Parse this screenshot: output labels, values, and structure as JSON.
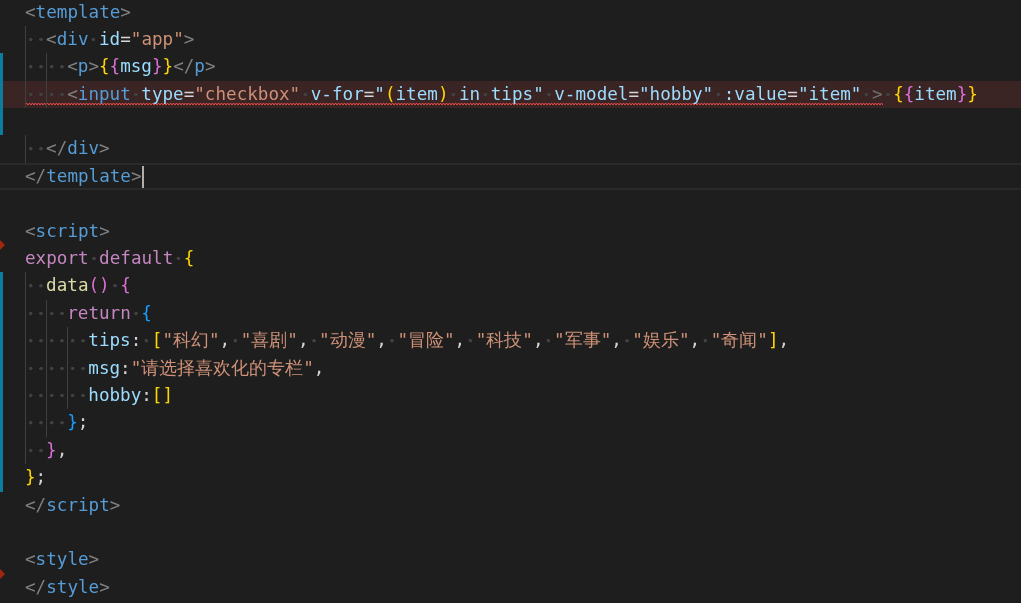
{
  "editor": {
    "lines": [
      {
        "modified": false,
        "deleted": false,
        "error": false,
        "current": false,
        "tokens": [
          {
            "kind": "bracket",
            "text": "<"
          },
          {
            "kind": "tag",
            "text": "template"
          },
          {
            "kind": "bracket",
            "text": ">"
          }
        ]
      },
      {
        "modified": false,
        "deleted": false,
        "error": false,
        "current": false,
        "tokens": [
          {
            "kind": "bracket",
            "text": "  <"
          },
          {
            "kind": "tag",
            "text": "div"
          },
          {
            "kind": "attr",
            "text": " id"
          },
          {
            "kind": "punct",
            "text": "="
          },
          {
            "kind": "string",
            "text": "\"app\""
          },
          {
            "kind": "bracket",
            "text": ">"
          }
        ]
      },
      {
        "modified": true,
        "deleted": false,
        "error": false,
        "current": false,
        "tokens": [
          {
            "kind": "bracket",
            "text": "    <"
          },
          {
            "kind": "tag",
            "text": "p"
          },
          {
            "kind": "bracket",
            "text": ">"
          },
          {
            "kind": "brace1",
            "text": "{"
          },
          {
            "kind": "brace2",
            "text": "{"
          },
          {
            "kind": "var",
            "text": "msg"
          },
          {
            "kind": "brace2",
            "text": "}"
          },
          {
            "kind": "brace1",
            "text": "}"
          },
          {
            "kind": "bracket",
            "text": "</"
          },
          {
            "kind": "tag",
            "text": "p"
          },
          {
            "kind": "bracket",
            "text": ">"
          }
        ]
      },
      {
        "modified": true,
        "deleted": false,
        "error": true,
        "current": false,
        "segments": [
          {
            "squiggle": true,
            "tokens": [
              {
                "kind": "bracket",
                "text": "    <"
              },
              {
                "kind": "tag",
                "text": "input"
              },
              {
                "kind": "attr",
                "text": " type"
              },
              {
                "kind": "punct",
                "text": "="
              },
              {
                "kind": "string",
                "text": "\"checkbox\""
              },
              {
                "kind": "attr",
                "text": " v-for"
              },
              {
                "kind": "punct",
                "text": "="
              },
              {
                "kind": "var",
                "text": "\""
              },
              {
                "kind": "brace1",
                "text": "("
              },
              {
                "kind": "var",
                "text": "item"
              },
              {
                "kind": "brace1",
                "text": ")"
              },
              {
                "kind": "var",
                "text": " in tips\""
              },
              {
                "kind": "attr",
                "text": " v-model"
              },
              {
                "kind": "punct",
                "text": "="
              },
              {
                "kind": "var",
                "text": "\"hobby\""
              },
              {
                "kind": "attr",
                "text": " :value"
              },
              {
                "kind": "punct",
                "text": "="
              },
              {
                "kind": "var",
                "text": "\"item\""
              },
              {
                "kind": "dim",
                "text": " >"
              }
            ]
          },
          {
            "squiggle": false,
            "tokens": [
              {
                "kind": "brace1",
                "text": " {"
              },
              {
                "kind": "brace2",
                "text": "{"
              },
              {
                "kind": "var",
                "text": "item"
              },
              {
                "kind": "brace2",
                "text": "}"
              },
              {
                "kind": "brace1",
                "text": "}"
              }
            ]
          }
        ]
      },
      {
        "modified": true,
        "deleted": false,
        "error": false,
        "current": false
      },
      {
        "modified": false,
        "deleted": false,
        "error": false,
        "current": false,
        "tokens": [
          {
            "kind": "bracket",
            "text": "  </"
          },
          {
            "kind": "tag",
            "text": "div"
          },
          {
            "kind": "bracket",
            "text": ">"
          }
        ]
      },
      {
        "modified": false,
        "deleted": false,
        "error": false,
        "current": true,
        "tokens": [
          {
            "kind": "bracket",
            "text": "</"
          },
          {
            "kind": "tag",
            "text": "template"
          },
          {
            "kind": "bracket",
            "text": ">"
          }
        ]
      },
      {
        "modified": false,
        "deleted": false,
        "error": false,
        "current": false
      },
      {
        "modified": false,
        "deleted": false,
        "error": false,
        "current": false,
        "tokens": [
          {
            "kind": "bracket",
            "text": "<"
          },
          {
            "kind": "tag",
            "text": "script"
          },
          {
            "kind": "bracket",
            "text": ">"
          }
        ]
      },
      {
        "modified": false,
        "deleted": true,
        "error": false,
        "current": false,
        "tokens": [
          {
            "kind": "keyword",
            "text": "export default"
          },
          {
            "kind": "brace1",
            "text": " {"
          }
        ]
      },
      {
        "modified": true,
        "deleted": false,
        "error": false,
        "current": false,
        "tokens": [
          {
            "kind": "func",
            "text": "  data"
          },
          {
            "kind": "brace2",
            "text": "()"
          },
          {
            "kind": "brace2",
            "text": " {"
          }
        ]
      },
      {
        "modified": true,
        "deleted": false,
        "error": false,
        "current": false,
        "tokens": [
          {
            "kind": "keyword",
            "text": "    return"
          },
          {
            "kind": "brace3",
            "text": " {"
          }
        ]
      },
      {
        "modified": true,
        "deleted": false,
        "error": false,
        "current": false,
        "tokens": [
          {
            "kind": "var",
            "text": "      tips"
          },
          {
            "kind": "punct",
            "text": ":"
          },
          {
            "kind": "brace1",
            "text": " ["
          },
          {
            "kind": "string",
            "text": "\"科幻\""
          },
          {
            "kind": "punct",
            "text": ","
          },
          {
            "kind": "string",
            "text": " \"喜剧\""
          },
          {
            "kind": "punct",
            "text": ","
          },
          {
            "kind": "string",
            "text": " \"动漫\""
          },
          {
            "kind": "punct",
            "text": ","
          },
          {
            "kind": "string",
            "text": " \"冒险\""
          },
          {
            "kind": "punct",
            "text": ","
          },
          {
            "kind": "string",
            "text": " \"科技\""
          },
          {
            "kind": "punct",
            "text": ","
          },
          {
            "kind": "string",
            "text": " \"军事\""
          },
          {
            "kind": "punct",
            "text": ","
          },
          {
            "kind": "string",
            "text": " \"娱乐\""
          },
          {
            "kind": "punct",
            "text": ","
          },
          {
            "kind": "string",
            "text": " \"奇闻\""
          },
          {
            "kind": "brace1",
            "text": "]"
          },
          {
            "kind": "punct",
            "text": ","
          }
        ]
      },
      {
        "modified": true,
        "deleted": false,
        "error": false,
        "current": false,
        "tokens": [
          {
            "kind": "var",
            "text": "      msg"
          },
          {
            "kind": "punct",
            "text": ":"
          },
          {
            "kind": "string",
            "text": "\"请选择喜欢化的专栏\""
          },
          {
            "kind": "punct",
            "text": ","
          }
        ]
      },
      {
        "modified": true,
        "deleted": false,
        "error": false,
        "current": false,
        "tokens": [
          {
            "kind": "var",
            "text": "      hobby"
          },
          {
            "kind": "punct",
            "text": ":"
          },
          {
            "kind": "brace1",
            "text": "[]"
          }
        ]
      },
      {
        "modified": true,
        "deleted": false,
        "error": false,
        "current": false,
        "tokens": [
          {
            "kind": "brace3",
            "text": "    }"
          },
          {
            "kind": "punct",
            "text": ";"
          }
        ]
      },
      {
        "modified": true,
        "deleted": false,
        "error": false,
        "current": false,
        "tokens": [
          {
            "kind": "brace2",
            "text": "  }"
          },
          {
            "kind": "punct",
            "text": ","
          }
        ]
      },
      {
        "modified": true,
        "deleted": false,
        "error": false,
        "current": false,
        "tokens": [
          {
            "kind": "brace1",
            "text": "}"
          },
          {
            "kind": "punct",
            "text": ";"
          }
        ]
      },
      {
        "modified": false,
        "deleted": false,
        "error": false,
        "current": false,
        "tokens": [
          {
            "kind": "bracket",
            "text": "</"
          },
          {
            "kind": "tag",
            "text": "script"
          },
          {
            "kind": "bracket",
            "text": ">"
          }
        ]
      },
      {
        "modified": false,
        "deleted": false,
        "error": false,
        "current": false
      },
      {
        "modified": false,
        "deleted": false,
        "error": false,
        "current": false,
        "tokens": [
          {
            "kind": "bracket",
            "text": "<"
          },
          {
            "kind": "tag",
            "text": "style"
          },
          {
            "kind": "bracket",
            "text": ">"
          }
        ]
      },
      {
        "modified": false,
        "deleted": true,
        "error": false,
        "current": false,
        "tokens": [
          {
            "kind": "bracket",
            "text": "</"
          },
          {
            "kind": "tag",
            "text": "style"
          },
          {
            "kind": "bracket",
            "text": ">"
          }
        ]
      }
    ]
  }
}
